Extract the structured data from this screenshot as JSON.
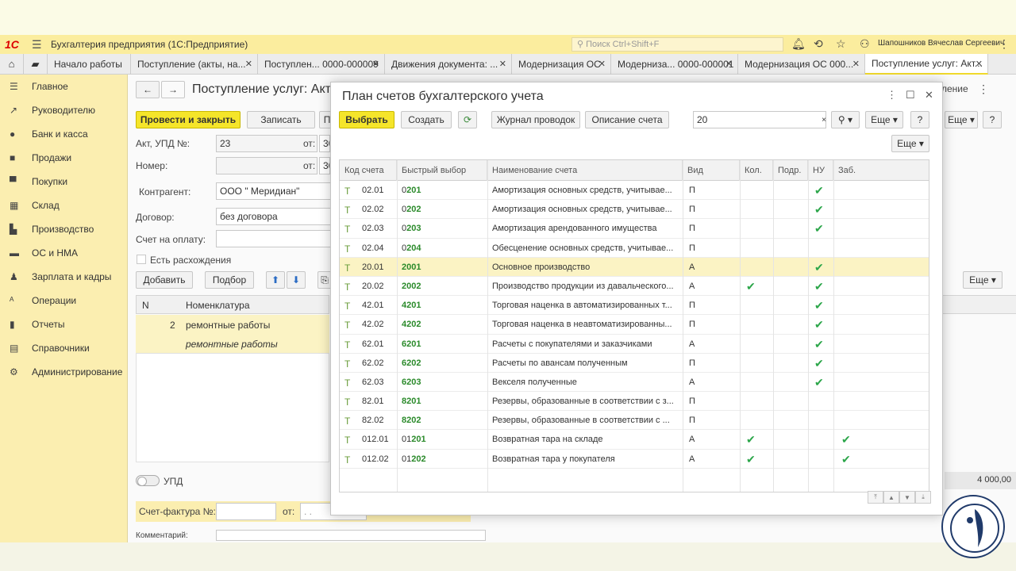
{
  "app": {
    "title": "Бухгалтерия предприятия  (1С:Предприятие)",
    "search_placeholder": "Поиск Ctrl+Shift+F",
    "user": "Шапошников Вячеслав Сергеевич"
  },
  "tabs": [
    {
      "label": "Начало работы"
    },
    {
      "label": "Поступление (акты, на..."
    },
    {
      "label": "Поступлен... 0000-000009"
    },
    {
      "label": "Движения документа: ..."
    },
    {
      "label": "Модернизация ОС"
    },
    {
      "label": "Модерниза... 0000-000001"
    },
    {
      "label": "Модернизация ОС 000..."
    },
    {
      "label": "Поступление услуг: Акт..."
    }
  ],
  "sidebar": [
    {
      "label": "Главное"
    },
    {
      "label": "Руководителю"
    },
    {
      "label": "Банк и касса"
    },
    {
      "label": "Продажи"
    },
    {
      "label": "Покупки"
    },
    {
      "label": "Склад"
    },
    {
      "label": "Производство"
    },
    {
      "label": "ОС и НМА"
    },
    {
      "label": "Зарплата и кадры"
    },
    {
      "label": "Операции"
    },
    {
      "label": "Отчеты"
    },
    {
      "label": "Справочники"
    },
    {
      "label": "Администрирование"
    }
  ],
  "doc": {
    "title": "Поступление услуг: Акт,",
    "post_close": "Провести и закрыть",
    "save": "Записать",
    "p_btn": "П",
    "act_label": "Акт, УПД №:",
    "act_value": "23",
    "ot_label": "от:",
    "ot_value": "30",
    "number_label": "Номер:",
    "ot2_label": "от:",
    "ot2_value": "30",
    "contractor_label": "Контрагент:",
    "contractor_value": "ООО \" Меридиан\"",
    "contract_label": "Договор:",
    "contract_value": "без договора",
    "invoice_label": "Счет на оплату:",
    "discrepancy": "Есть расхождения",
    "add": "Добавить",
    "pick": "Подбор",
    "col_n": "N",
    "col_nom": "Номенклатура",
    "row_n": "2",
    "row_nom": "ремонтные работы",
    "row_nom2": "ремонтные работы",
    "upd": "УПД",
    "sf_label": "Счет-фактура №:",
    "sf_ot": "от:",
    "sf_date": ". .",
    "comment": "Комментарий:",
    "more": "Еще",
    "more2": "Еще",
    "right_tail": "ление",
    "sum": "4 000,00"
  },
  "modal": {
    "title": "План счетов бухгалтерского учета",
    "select": "Выбрать",
    "create": "Создать",
    "journal": "Журнал проводок",
    "desc": "Описание счета",
    "search_value": "20",
    "more": "Еще",
    "more2": "Еще",
    "help": "?",
    "columns": {
      "code": "Код счета",
      "fast": "Быстрый выбор",
      "name": "Наименование счета",
      "kind": "Вид",
      "qty": "Кол.",
      "sub": "Подр.",
      "nu": "НУ",
      "zab": "Заб."
    },
    "rows": [
      {
        "code": "02.01",
        "fast_pre": "0",
        "fast": "201",
        "name": "Амортизация основных средств, учитывае...",
        "kind": "П",
        "qty": false,
        "nu": true,
        "zab": false
      },
      {
        "code": "02.02",
        "fast_pre": "0",
        "fast": "202",
        "name": "Амортизация основных средств, учитывае...",
        "kind": "П",
        "qty": false,
        "nu": true,
        "zab": false
      },
      {
        "code": "02.03",
        "fast_pre": "0",
        "fast": "203",
        "name": "Амортизация арендованного имущества",
        "kind": "П",
        "qty": false,
        "nu": true,
        "zab": false
      },
      {
        "code": "02.04",
        "fast_pre": "0",
        "fast": "204",
        "name": "Обесценение основных средств, учитывае...",
        "kind": "П",
        "qty": false,
        "nu": false,
        "zab": false
      },
      {
        "code": "20.01",
        "fast_pre": "",
        "fast": "2001",
        "name": "Основное производство",
        "kind": "А",
        "qty": false,
        "nu": true,
        "zab": false,
        "selected": true
      },
      {
        "code": "20.02",
        "fast_pre": "",
        "fast": "2002",
        "name": "Производство продукции из давальческого...",
        "kind": "А",
        "qty": true,
        "nu": true,
        "zab": false
      },
      {
        "code": "42.01",
        "fast_pre": "",
        "fast": "4201",
        "name": "Торговая наценка в автоматизированных т...",
        "kind": "П",
        "qty": false,
        "nu": true,
        "zab": false
      },
      {
        "code": "42.02",
        "fast_pre": "",
        "fast": "4202",
        "name": "Торговая наценка в неавтоматизированны...",
        "kind": "П",
        "qty": false,
        "nu": true,
        "zab": false
      },
      {
        "code": "62.01",
        "fast_pre": "",
        "fast": "6201",
        "name": "Расчеты с покупателями и заказчиками",
        "kind": "А",
        "qty": false,
        "nu": true,
        "zab": false
      },
      {
        "code": "62.02",
        "fast_pre": "",
        "fast": "6202",
        "name": "Расчеты по авансам полученным",
        "kind": "П",
        "qty": false,
        "nu": true,
        "zab": false
      },
      {
        "code": "62.03",
        "fast_pre": "",
        "fast": "6203",
        "name": "Векселя полученные",
        "kind": "А",
        "qty": false,
        "nu": true,
        "zab": false
      },
      {
        "code": "82.01",
        "fast_pre": "",
        "fast": "8201",
        "name": "Резервы, образованные в соответствии с з...",
        "kind": "П",
        "qty": false,
        "nu": false,
        "zab": false
      },
      {
        "code": "82.02",
        "fast_pre": "",
        "fast": "8202",
        "name": "Резервы, образованные в соответствии с ...",
        "kind": "П",
        "qty": false,
        "nu": false,
        "zab": false
      },
      {
        "code": "012.01",
        "fast_pre": "01",
        "fast": "201",
        "name": "Возвратная тара на складе",
        "kind": "А",
        "qty": true,
        "nu": false,
        "zab": true
      },
      {
        "code": "012.02",
        "fast_pre": "01",
        "fast": "202",
        "name": "Возвратная тара у покупателя",
        "kind": "А",
        "qty": true,
        "nu": false,
        "zab": true
      }
    ]
  }
}
